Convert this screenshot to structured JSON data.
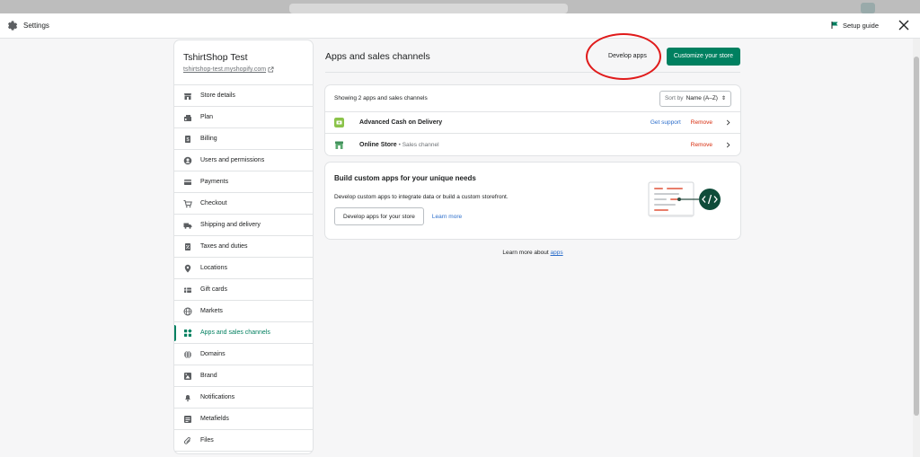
{
  "modal": {
    "title": "Settings",
    "setup_guide": "Setup guide"
  },
  "store": {
    "name": "TshirtShop Test",
    "url": "tshirtshop-test.myshopify.com"
  },
  "nav": [
    {
      "label": "Store details",
      "icon": "store-icon"
    },
    {
      "label": "Plan",
      "icon": "plan-icon"
    },
    {
      "label": "Billing",
      "icon": "billing-icon"
    },
    {
      "label": "Users and permissions",
      "icon": "user-icon"
    },
    {
      "label": "Payments",
      "icon": "payments-icon"
    },
    {
      "label": "Checkout",
      "icon": "cart-icon"
    },
    {
      "label": "Shipping and delivery",
      "icon": "truck-icon"
    },
    {
      "label": "Taxes and duties",
      "icon": "tax-icon"
    },
    {
      "label": "Locations",
      "icon": "location-pin-icon"
    },
    {
      "label": "Gift cards",
      "icon": "gift-card-icon"
    },
    {
      "label": "Markets",
      "icon": "globe-icon"
    },
    {
      "label": "Apps and sales channels",
      "icon": "apps-icon",
      "active": true
    },
    {
      "label": "Domains",
      "icon": "domain-globe-icon"
    },
    {
      "label": "Brand",
      "icon": "brand-icon"
    },
    {
      "label": "Notifications",
      "icon": "bell-icon"
    },
    {
      "label": "Metafields",
      "icon": "metafields-icon"
    },
    {
      "label": "Files",
      "icon": "paperclip-icon"
    }
  ],
  "main": {
    "title": "Apps and sales channels",
    "develop_apps": "Develop apps",
    "customize": "Customize your store",
    "apps_count": "Showing 2 apps and sales channels",
    "sort_label": "Sort by",
    "sort_value": "Name (A–Z)",
    "apps": [
      {
        "name": "Advanced Cash on Delivery",
        "sub": "",
        "support": "Get support",
        "remove": "Remove",
        "icon_color": "#8bc34a"
      },
      {
        "name": "Online Store",
        "sub": "• Sales channel",
        "support": "",
        "remove": "Remove",
        "icon_color": "#3f8f5a"
      }
    ],
    "custom": {
      "title": "Build custom apps for your unique needs",
      "desc": "Develop custom apps to integrate data or build a custom storefront.",
      "button": "Develop apps for your store",
      "learn": "Learn more"
    },
    "footer_text": "Learn more about",
    "footer_link": "apps"
  },
  "colors": {
    "accent": "#008060",
    "remove": "#d72c0d",
    "link": "#2c6ecb",
    "annotation": "#e01b1b"
  }
}
